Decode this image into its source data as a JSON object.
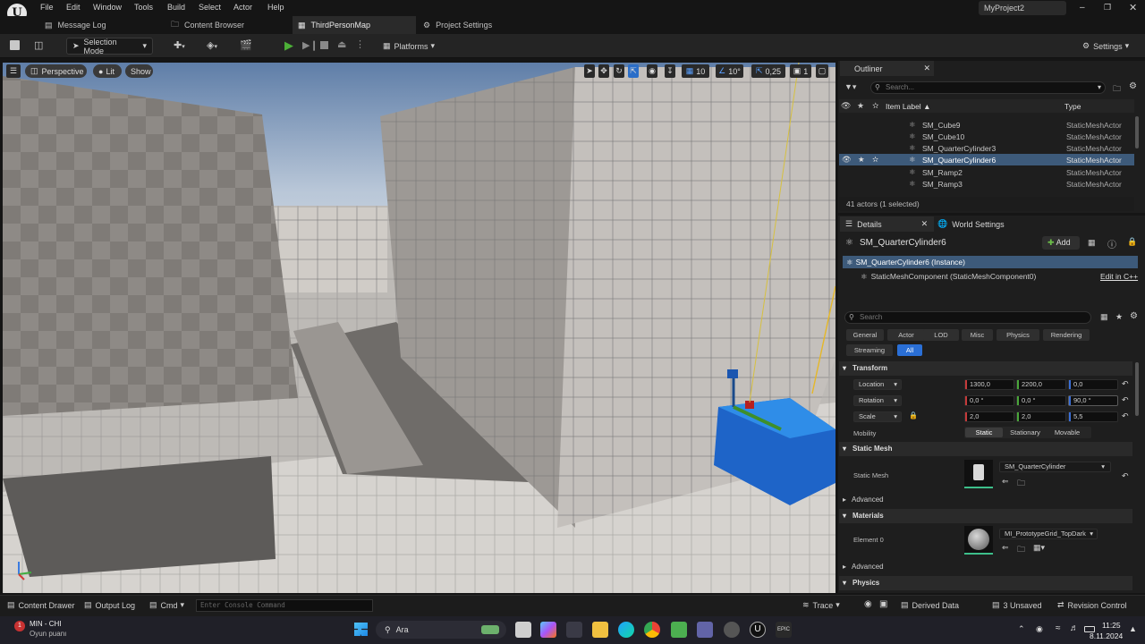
{
  "menu": [
    "File",
    "Edit",
    "Window",
    "Tools",
    "Build",
    "Select",
    "Actor",
    "Help"
  ],
  "project_name": "MyProject2",
  "tabs": [
    {
      "label": "Message Log"
    },
    {
      "label": "Content Browser"
    },
    {
      "label": "ThirdPersonMap"
    },
    {
      "label": "Project Settings"
    }
  ],
  "toolbar": {
    "selection_mode": "Selection Mode",
    "platforms": "Platforms",
    "settings": "Settings"
  },
  "viewport": {
    "perspective": "Perspective",
    "lit": "Lit",
    "show": "Show",
    "grid_snap": "10",
    "rot_snap": "10°",
    "scale_snap": "0,25",
    "camera_speed": "1"
  },
  "outliner": {
    "title": "Outliner",
    "search_placeholder": "Search...",
    "col_label": "Item Label",
    "col_type": "Type",
    "rows": [
      {
        "name": "SM_Cube9",
        "type": "StaticMeshActor"
      },
      {
        "name": "SM_Cube10",
        "type": "StaticMeshActor"
      },
      {
        "name": "SM_QuarterCylinder3",
        "type": "StaticMeshActor"
      },
      {
        "name": "SM_QuarterCylinder6",
        "type": "StaticMeshActor"
      },
      {
        "name": "SM_Ramp2",
        "type": "StaticMeshActor"
      },
      {
        "name": "SM_Ramp3",
        "type": "StaticMeshActor"
      }
    ],
    "footer": "41 actors (1 selected)"
  },
  "details": {
    "tab_details": "Details",
    "tab_world": "World Settings",
    "actor_name": "SM_QuarterCylinder6",
    "add_label": "Add",
    "instance": "SM_QuarterCylinder6 (Instance)",
    "component": "StaticMeshComponent (StaticMeshComponent0)",
    "edit_cpp": "Edit in C++",
    "search_placeholder": "Search",
    "categories": [
      "General",
      "Actor",
      "LOD",
      "Misc",
      "Physics",
      "Rendering",
      "Streaming",
      "All"
    ],
    "transform_title": "Transform",
    "location_label": "Location",
    "rotation_label": "Rotation",
    "scale_label": "Scale",
    "location": [
      "1300,0",
      "2200,0",
      "0,0"
    ],
    "rotation": [
      "0,0 °",
      "0,0 °",
      "90,0 °"
    ],
    "scale": [
      "2,0",
      "2,0",
      "5,5"
    ],
    "mobility_label": "Mobility",
    "mobility": [
      "Static",
      "Stationary",
      "Movable"
    ],
    "static_mesh_title": "Static Mesh",
    "static_mesh_label": "Static Mesh",
    "static_mesh_value": "SM_QuarterCylinder",
    "advanced": "Advanced",
    "materials_title": "Materials",
    "element0_label": "Element 0",
    "material_value": "MI_PrototypeGrid_TopDark",
    "physics_title": "Physics"
  },
  "statusbar": {
    "content_drawer": "Content Drawer",
    "output_log": "Output Log",
    "cmd": "Cmd",
    "console_placeholder": "Enter Console Command",
    "trace": "Trace",
    "derived_data": "Derived Data",
    "unsaved": "3 Unsaved",
    "revision": "Revision Control"
  },
  "taskbar": {
    "notif_title": "MIN - CHI",
    "notif_sub": "Oyun puanı",
    "search": "Ara",
    "time": "11:25",
    "date": "8.11.2024"
  }
}
